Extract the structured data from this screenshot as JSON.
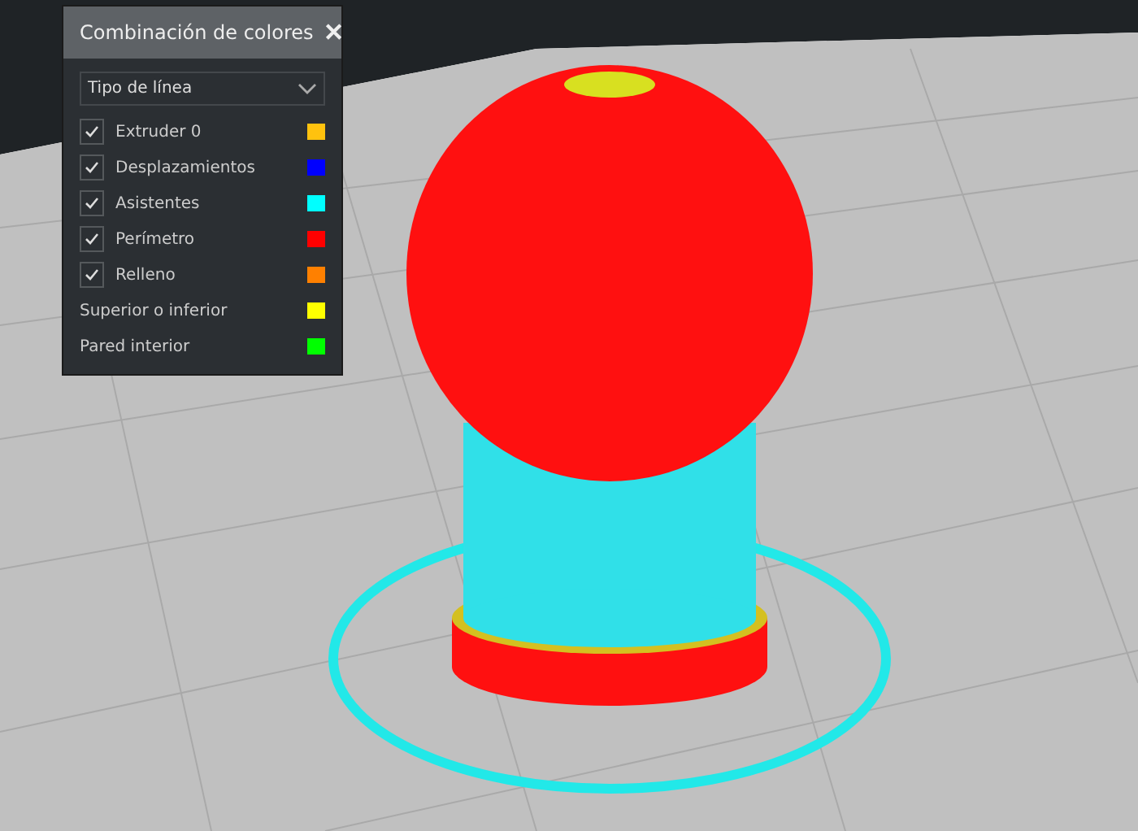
{
  "panel": {
    "title": "Combinación de colores",
    "close": "✕",
    "dropdown": {
      "value": "Tipo de línea"
    },
    "items": [
      {
        "kind": "checkbox",
        "label": "Extruder 0",
        "checked": true,
        "color": "#ffc20e"
      },
      {
        "kind": "checkbox",
        "label": "Desplazamientos",
        "checked": true,
        "color": "#0000ff"
      },
      {
        "kind": "checkbox",
        "label": "Asistentes",
        "checked": true,
        "color": "#00ffff"
      },
      {
        "kind": "checkbox",
        "label": "Perímetro",
        "checked": true,
        "color": "#ff0000"
      },
      {
        "kind": "checkbox",
        "label": "Relleno",
        "checked": true,
        "color": "#ff8000"
      },
      {
        "kind": "plain",
        "label": "Superior o inferior",
        "color": "#ffff00"
      },
      {
        "kind": "plain",
        "label": "Pared interior",
        "color": "#00ff00"
      }
    ]
  }
}
